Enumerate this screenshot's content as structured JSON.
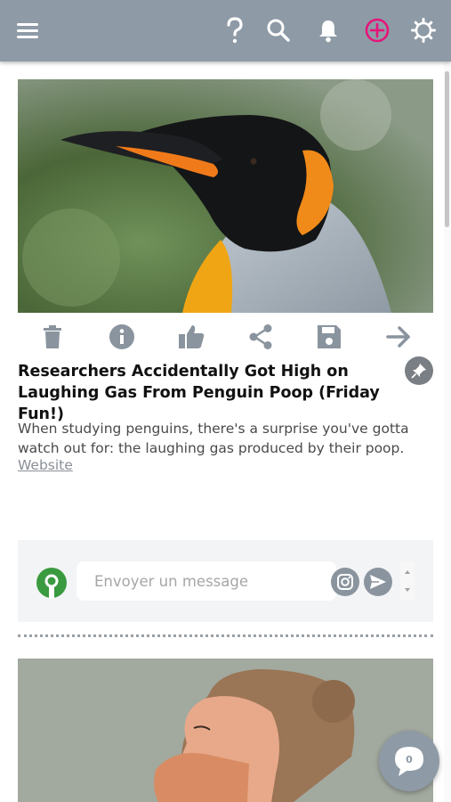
{
  "header": {
    "icons": [
      "menu-icon",
      "help-icon",
      "search-icon",
      "bell-icon",
      "add-circle-icon",
      "gear-icon"
    ],
    "accent": "#e6147a",
    "background": "#8e9aa6"
  },
  "post": {
    "title": "Researchers Accidentally Got High on Laughing Gas From Penguin Poop (Friday Fun!)",
    "description": "When studying penguins, there's a surprise you've gotta watch out for: the laughing gas produced by their poop.",
    "link_label": "Website",
    "actions": [
      "trash-icon",
      "info-icon",
      "thumbs-up-icon",
      "share-icon",
      "save-icon",
      "arrow-right-icon"
    ]
  },
  "message": {
    "placeholder": "Envoyer un message"
  },
  "chat": {
    "count": "0"
  },
  "colors": {
    "avatar_green": "#3a9a3f",
    "panel_bg": "#f3f4f6"
  }
}
